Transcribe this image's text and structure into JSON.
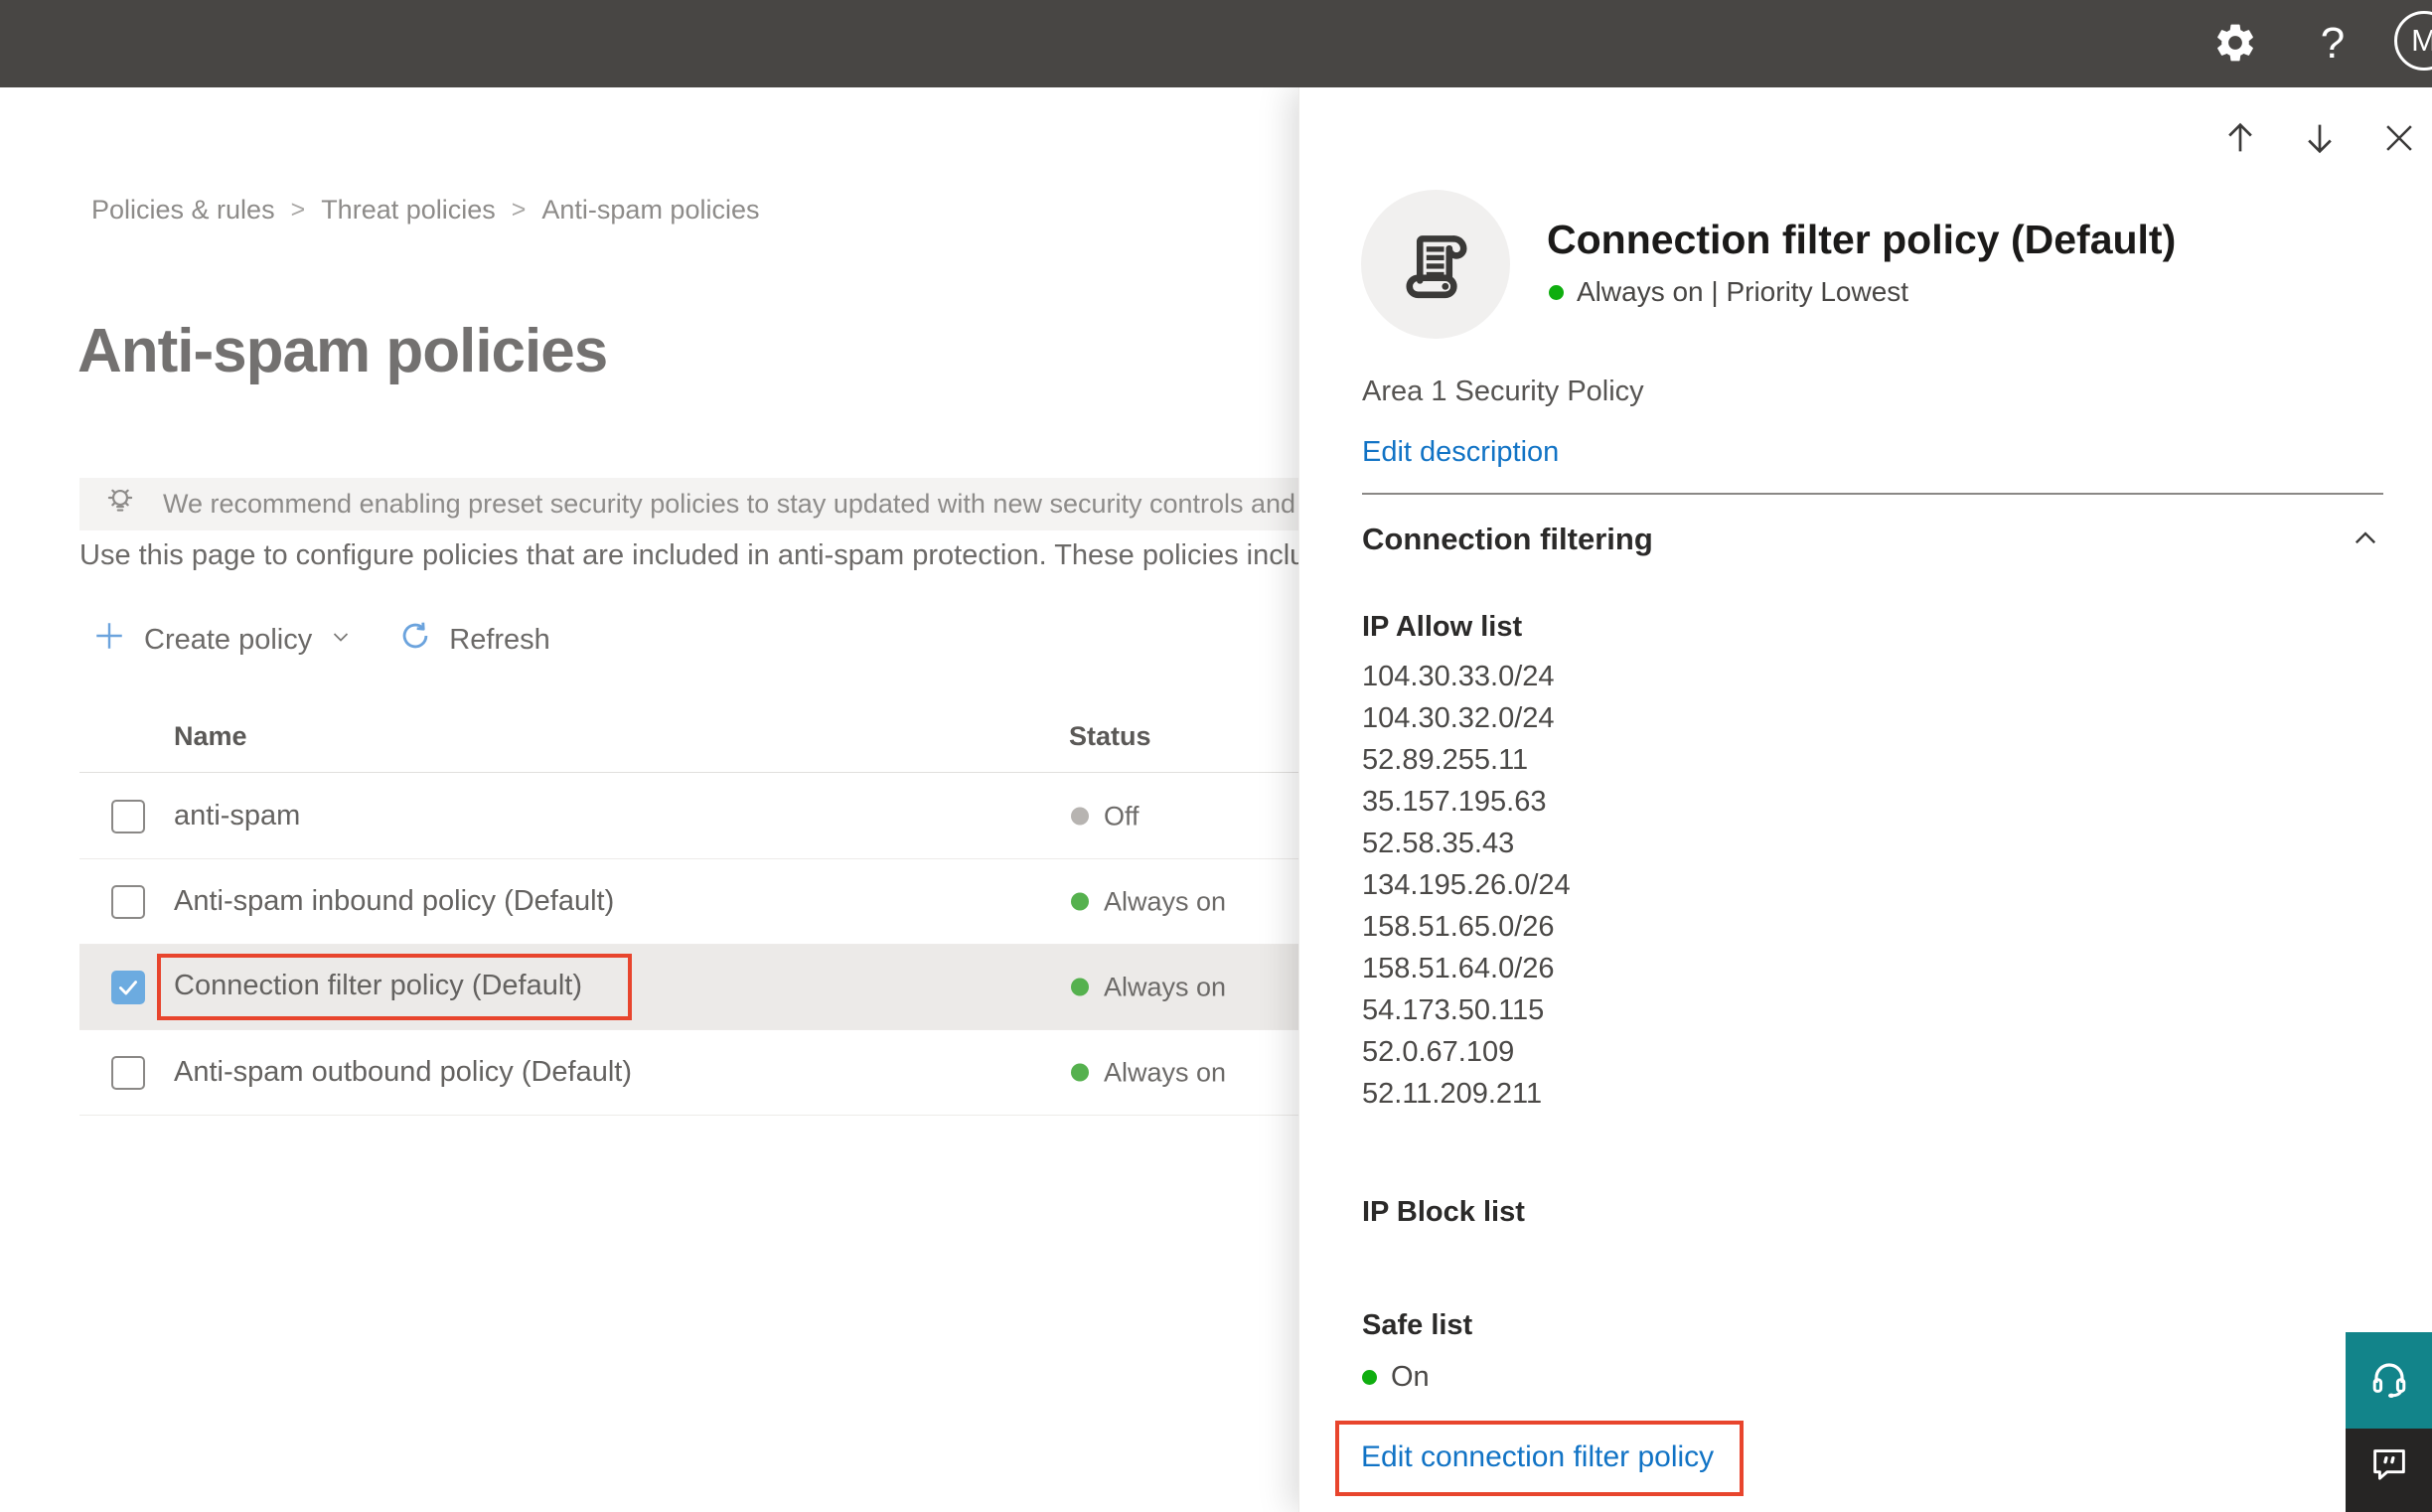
{
  "topbar": {
    "avatar_initial": "M"
  },
  "breadcrumb": {
    "separator": ">",
    "items": [
      "Policies & rules",
      "Threat policies",
      "Anti-spam policies"
    ]
  },
  "page": {
    "title": "Anti-spam policies",
    "banner_text": "We recommend enabling preset security policies to stay updated with new security controls and our recomme",
    "intro_text": "Use this page to configure policies that are included in anti-spam protection. These policies include",
    "toolbar": {
      "create_label": "Create policy",
      "refresh_label": "Refresh"
    }
  },
  "table": {
    "columns": [
      "Name",
      "Status"
    ],
    "rows": [
      {
        "name": "anti-spam",
        "status": "Off",
        "state": "off",
        "checked": false,
        "selected": false,
        "highlight_name": false
      },
      {
        "name": "Anti-spam inbound policy (Default)",
        "status": "Always on",
        "state": "on",
        "checked": false,
        "selected": false,
        "highlight_name": false
      },
      {
        "name": "Connection filter policy (Default)",
        "status": "Always on",
        "state": "on",
        "checked": true,
        "selected": true,
        "highlight_name": true
      },
      {
        "name": "Anti-spam outbound policy (Default)",
        "status": "Always on",
        "state": "on",
        "checked": false,
        "selected": false,
        "highlight_name": false
      }
    ]
  },
  "flyout": {
    "title": "Connection filter policy (Default)",
    "status_line": "Always on | Priority Lowest",
    "description": "Area 1 Security Policy",
    "edit_description_label": "Edit description",
    "section_title": "Connection filtering",
    "ip_allow": {
      "label": "IP Allow list",
      "items": [
        "104.30.33.0/24",
        "104.30.32.0/24",
        "52.89.255.11",
        "35.157.195.63",
        "52.58.35.43",
        "134.195.26.0/24",
        "158.51.65.0/26",
        "158.51.64.0/26",
        "54.173.50.115",
        "52.0.67.109",
        "52.11.209.211"
      ]
    },
    "ip_block": {
      "label": "IP Block list"
    },
    "safe_list": {
      "label": "Safe list",
      "status": "On"
    },
    "edit_link_label": "Edit connection filter policy"
  },
  "colors": {
    "red-annotation": "#e8452d",
    "link-blue": "#1173c5",
    "icon-blue": "#6ba3dd",
    "green-on": "#0fae0f",
    "green-row": "#55b14e",
    "gray-off": "#b7b4b1",
    "teal-help": "#12848a",
    "chat-dark": "#262524",
    "topbar-bg": "#484644",
    "checkbox-blue": "#6cabe0",
    "row-selected": "#eceae8",
    "banner-bg": "#f4f3f2"
  }
}
